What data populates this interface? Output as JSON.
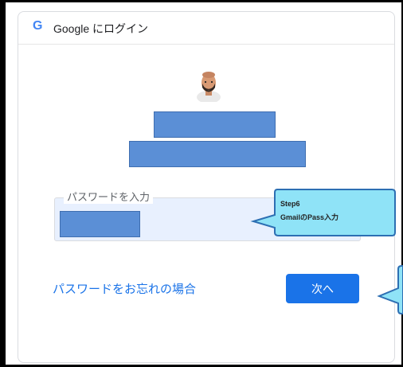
{
  "header": {
    "logo": "G",
    "title": "Google にログイン"
  },
  "password": {
    "label": "パスワードを入力"
  },
  "links": {
    "forgot": "パスワードをお忘れの場合"
  },
  "buttons": {
    "next": "次へ"
  },
  "callout": {
    "step": "Step6",
    "text": "GmailのPass入力"
  },
  "colors": {
    "accent": "#1a73e8",
    "callout_fill": "#8fe3f7",
    "callout_border": "#2d6fb3",
    "redaction": "#5b8fd6"
  }
}
